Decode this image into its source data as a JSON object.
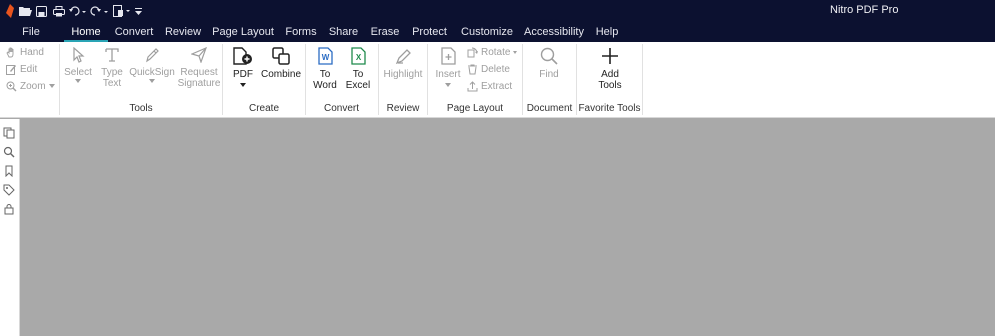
{
  "app": {
    "title": "Nitro PDF Pro"
  },
  "quick_access": [
    {
      "icon": "nitro-logo-icon"
    },
    {
      "icon": "open-folder-icon"
    },
    {
      "icon": "save-icon"
    },
    {
      "icon": "print-icon"
    },
    {
      "icon": "undo-icon"
    },
    {
      "icon": "redo-icon"
    },
    {
      "icon": "new-document-icon"
    },
    {
      "icon": "customize-toolbar-icon"
    }
  ],
  "tabs": [
    "File",
    "Home",
    "Convert",
    "Review",
    "Page Layout",
    "Forms",
    "Share",
    "Erase",
    "Protect",
    "Customize",
    "Accessibility",
    "Help"
  ],
  "active_tab": "Home",
  "ribbon": {
    "nav": {
      "hand": "Hand",
      "edit": "Edit",
      "zoom": "Zoom"
    },
    "tools": {
      "label": "Tools",
      "select": "Select",
      "type_text": [
        "Type",
        "Text"
      ],
      "quicksign": "QuickSign",
      "request_signature": [
        "Request",
        "Signature"
      ]
    },
    "create": {
      "label": "Create",
      "pdf": "PDF",
      "combine": "Combine"
    },
    "convert": {
      "label": "Convert",
      "to_word": [
        "To",
        "Word"
      ],
      "to_excel": [
        "To",
        "Excel"
      ]
    },
    "review": {
      "label": "Review",
      "highlight": "Highlight"
    },
    "page_layout": {
      "label": "Page Layout",
      "insert": "Insert",
      "rotate": "Rotate",
      "delete": "Delete",
      "extract": "Extract"
    },
    "document": {
      "label": "Document",
      "find": "Find"
    },
    "favorite_tools": {
      "label": "Favorite Tools",
      "add_tools": [
        "Add",
        "Tools"
      ]
    }
  },
  "colors": {
    "titlebar": "#0c1130",
    "accent": "#2aa4b5",
    "word": "#2b6cc4",
    "excel": "#1f8a4c",
    "nitro": "#e8541e",
    "canvas": "#a9a9a9"
  }
}
